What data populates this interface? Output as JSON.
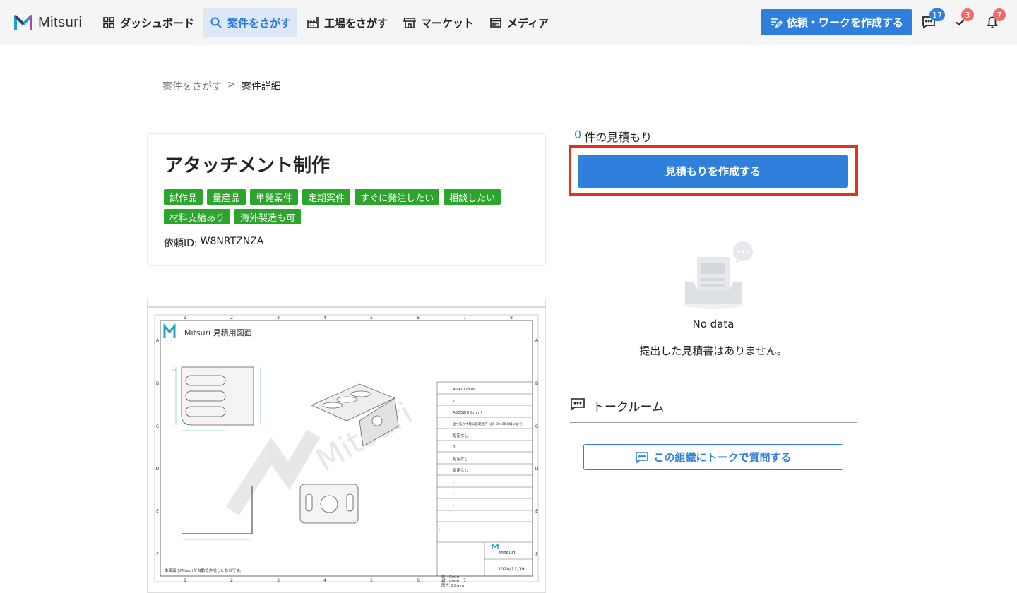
{
  "app": {
    "logo_text": "Mitsuri"
  },
  "nav": {
    "items": [
      {
        "label": "ダッシュボード",
        "icon": "grid-icon"
      },
      {
        "label": "案件をさがす",
        "icon": "search-icon",
        "active": true
      },
      {
        "label": "工場をさがす",
        "icon": "factory-icon"
      },
      {
        "label": "マーケット",
        "icon": "store-icon"
      },
      {
        "label": "メディア",
        "icon": "newspaper-icon"
      }
    ],
    "create_label": "依頼・ワークを作成する",
    "chat_badge": "17",
    "todo_badge": "3",
    "notify_badge": "7"
  },
  "breadcrumb": {
    "parent": "案件をさがす",
    "separator": ">",
    "current": "案件詳細"
  },
  "project": {
    "title": "アタッチメント制作",
    "tags": [
      "試作品",
      "量産品",
      "単発案件",
      "定期案件",
      "すぐに発注したい",
      "相談したい",
      "材料支給あり",
      "海外製造も可"
    ],
    "id_label": "依頼ID:",
    "id_value": "W8NRTZNZA"
  },
  "drawing": {
    "heading": "Mitsuri 見積用図面",
    "watermark": "Mitsuri",
    "col_numbers": [
      "1",
      "2",
      "3",
      "4",
      "5",
      "6",
      "7",
      "8"
    ],
    "row_letters": [
      "A",
      "B",
      "C",
      "D",
      "E",
      "F"
    ],
    "table_values": [
      "469702876",
      "1",
      "A5052(0.8mm)",
      "全寸法が中級公差範囲内（JIS B0408 B級に従う）",
      "指定なし",
      "0",
      "指定なし",
      "指定なし",
      "-",
      "-",
      "-",
      "-",
      "-"
    ],
    "stamp_logo": "Mitsuri",
    "date": "2020/11/19",
    "note": "本図面はMitsuriが自動で作成したものです。",
    "dims": [
      "縦:40mm",
      "横:79mm",
      "厚さ:0.8mm"
    ]
  },
  "quotes": {
    "count": "0",
    "count_suffix": "件の見積もり",
    "create_label": "見積もりを作成する",
    "empty_title": "No data",
    "empty_message": "提出した見積書はありません。"
  },
  "talk": {
    "header": "トークルーム",
    "button_label": "この組織にトークで質問する"
  },
  "colors": {
    "accent": "#2f80dc",
    "tag_green": "#2ca52c",
    "highlight_red": "#e8301c"
  }
}
